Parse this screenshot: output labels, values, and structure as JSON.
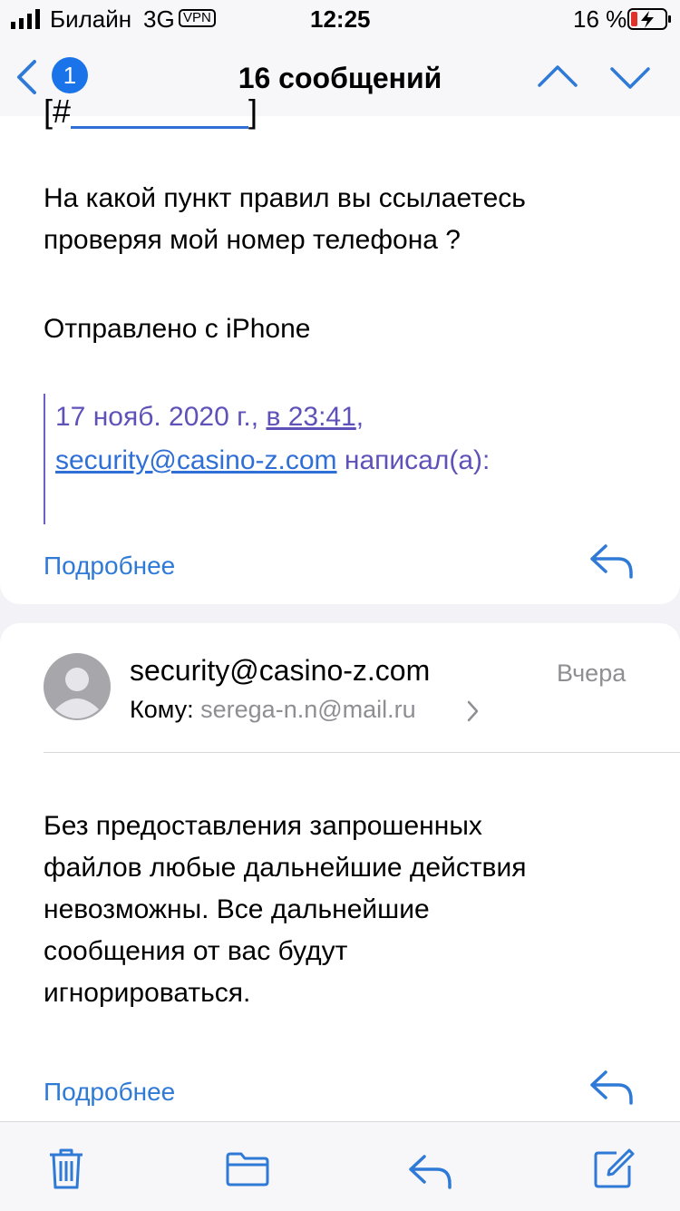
{
  "status_bar": {
    "carrier": "Билайн",
    "network": "3G",
    "vpn": "VPN",
    "time": "12:25",
    "battery": "16 %"
  },
  "nav": {
    "badge_count": "1",
    "title": "16 сообщений"
  },
  "message1": {
    "top_fragment_prefix": "[#",
    "top_fragment_suffix": "]",
    "body_line1": "На какой пункт правил вы ссылаетесь",
    "body_line2": "проверяя мой номер телефона ?",
    "signature": "Отправлено с iPhone",
    "quote_date": "17 нояб. 2020 г.",
    "quote_comma": ",",
    "quote_time": "в 23:41",
    "quote_comma2": ",",
    "quote_email": "security@casino-z.com",
    "quote_wrote": "написал(а):",
    "more_label": "Подробнее"
  },
  "message2": {
    "sender": "security@casino-z.com",
    "date": "Вчера",
    "to_label": "Кому:",
    "to_value": "serega-n.n@mail.ru",
    "body_lines": [
      "Без предоставления запрошенных",
      "файлов любые дальнейшие действия",
      "невозможны. Все дальнейшие",
      "сообщения от вас будут",
      "игнорироваться."
    ],
    "more_label": "Подробнее"
  },
  "icons": {
    "back": "chevron-left-icon",
    "up": "chevron-up-icon",
    "down": "chevron-down-icon",
    "trash": "trash-icon",
    "folder": "folder-icon",
    "reply": "reply-icon",
    "compose": "compose-icon"
  },
  "colors": {
    "accent": "#2f7ad6",
    "quote": "#5e52b8",
    "badge": "#1a73e8"
  }
}
